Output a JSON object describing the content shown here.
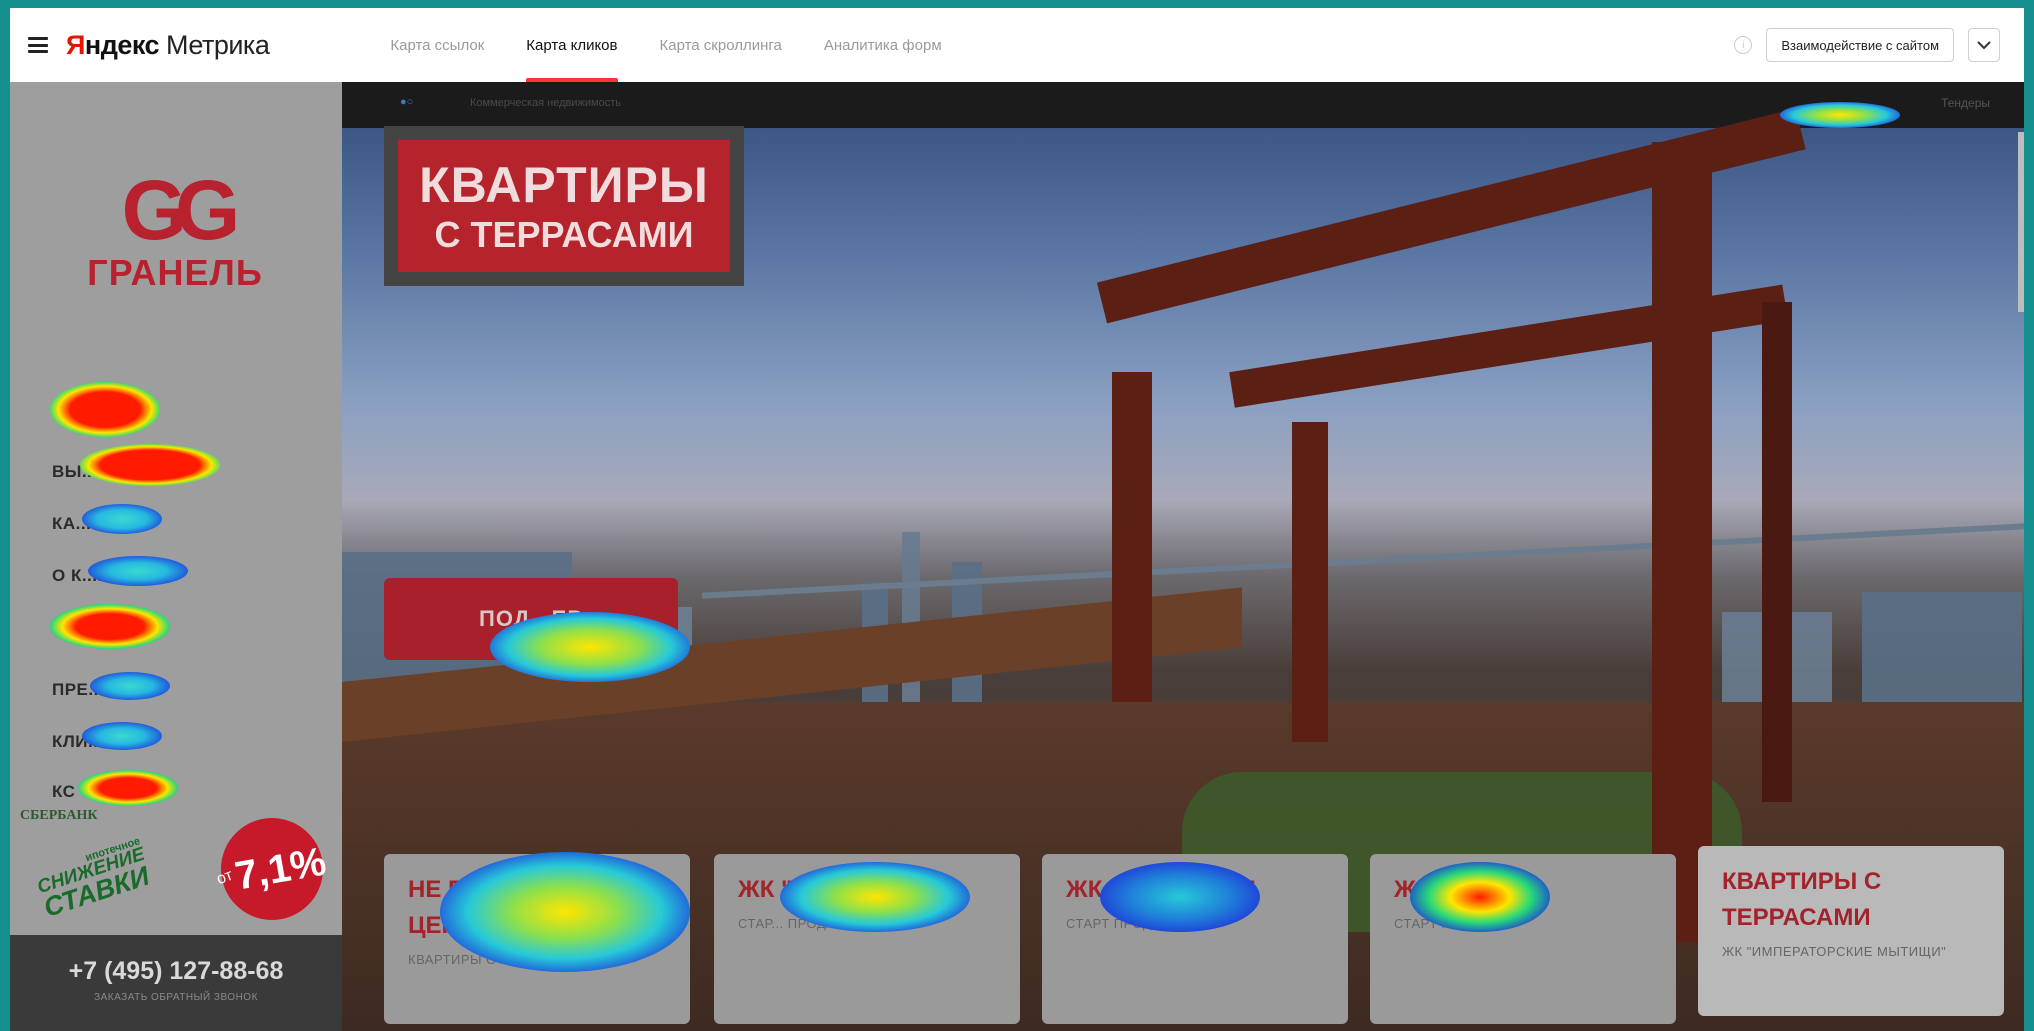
{
  "app": {
    "logo_ya": "Я",
    "logo_rest": "ндекс",
    "logo_product": "Метрика"
  },
  "tabs": [
    {
      "label": "Карта ссылок"
    },
    {
      "label": "Карта кликов"
    },
    {
      "label": "Карта скроллинга"
    },
    {
      "label": "Аналитика форм"
    }
  ],
  "toolbar": {
    "interaction_label": "Взаимодействие с сайтом"
  },
  "site": {
    "strip_left": "Коммерческая недвижимость",
    "strip_right": "Тендеры",
    "logo_mark": "GG",
    "logo_name": "ГРАНЕЛЬ",
    "nav": [
      "ВЫ...Ы",
      "КА...ИТЬ",
      "О К...ИИ",
      "ПРЕ...ТР",
      "КЛИ...М",
      "КС"
    ],
    "promo": {
      "bank": "СБЕРБАНК",
      "line_a": "ипотечное",
      "line_b": "СНИЖЕНИЕ",
      "line_c": "СТАВКИ",
      "rate_prefix": "от",
      "rate_value": "7,1%"
    },
    "phone": "+7 (495) 127-88-68",
    "callback": "ЗАКАЗАТЬ ОБРАТНЫЙ ЗВОНОК",
    "headline_1": "КВАРТИРЫ",
    "headline_2": "С ТЕРРАСАМИ",
    "cta": "ПОД...ЕР",
    "cards": [
      {
        "title": "НЕ П... ОНЬ РОСТ ЦЕН",
        "sub": "КВАРТИРЫ ОТ 13 МЛН РУБ"
      },
      {
        "title": "ЖК \"...ИНА\"",
        "sub": "СТАР... ПРОДАЖ"
      },
      {
        "title": "ЖК \"...ОВАЦИЯ\"",
        "sub": "СТАРТ ПРОДАЖ"
      },
      {
        "title": "Ж...ЕХРА\"",
        "sub": "СТАРТ ПРОДАЖ"
      },
      {
        "title": "КВАРТИРЫ С ТЕРРАСАМИ",
        "sub": "ЖК \"ИМПЕРАТОРСКИЕ МЫТИЩИ\""
      }
    ]
  }
}
